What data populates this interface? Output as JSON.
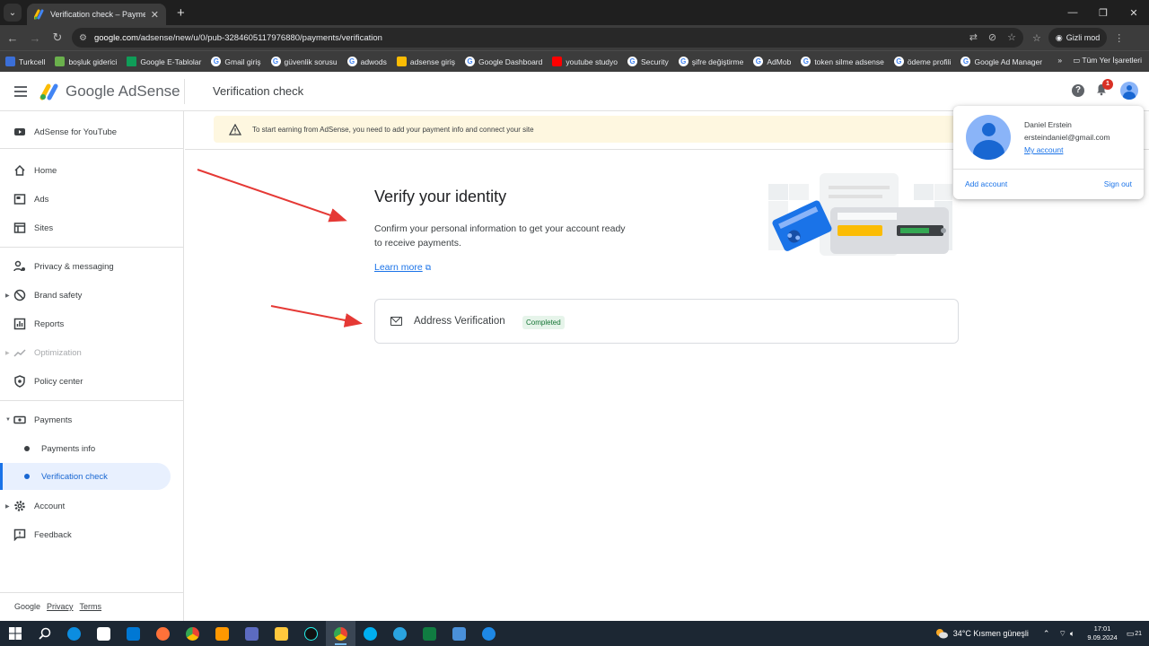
{
  "browser": {
    "tab_title": "Verification check – Payments –",
    "url_host": "google.com",
    "url_path": "/adsense/new/u/0/pub-3284605117976880/payments/verification",
    "incognito_label": "Gizli mod",
    "bookmarks": [
      "Turkcell",
      "boşluk giderici",
      "Google E-Tablolar",
      "Gmail giriş",
      "güvenlik sorusu",
      "adwods",
      "adsense giriş",
      "Google Dashboard",
      "youtube studyo",
      "Security",
      "şifre değiştirme",
      "AdMob",
      "token silme adsense",
      "ödeme profili",
      "Google Ad Manager"
    ],
    "all_bookmarks_label": "Tüm Yer İşaretleri"
  },
  "app": {
    "logo_text": "Google AdSense",
    "page_title": "Verification check",
    "notification_count": "1"
  },
  "sidebar": {
    "youtube": "AdSense for YouTube",
    "home": "Home",
    "ads": "Ads",
    "sites": "Sites",
    "privacy": "Privacy & messaging",
    "brand": "Brand safety",
    "reports": "Reports",
    "optimization": "Optimization",
    "policy": "Policy center",
    "payments": "Payments",
    "payments_info": "Payments info",
    "verification": "Verification check",
    "account": "Account",
    "feedback": "Feedback",
    "footer": {
      "google": "Google",
      "privacy": "Privacy",
      "terms": "Terms"
    }
  },
  "banner": {
    "text": "To start earning from AdSense, you need to add your payment info and connect your site"
  },
  "main": {
    "heading": "Verify your identity",
    "description": "Confirm your personal information to get your account ready to receive payments.",
    "learn_more": "Learn more",
    "card_title": "Address Verification",
    "card_status": "Completed"
  },
  "account_popup": {
    "name": "Daniel Erstein",
    "email": "ersteindaniel@gmail.com",
    "my_account": "My account",
    "add_account": "Add account",
    "sign_out": "Sign out"
  },
  "taskbar": {
    "weather": "34°C  Kısmen güneşli",
    "time": "17:01",
    "date": "9.09.2024",
    "notif_count": "21"
  },
  "colors": {
    "accent": "#1a73e8",
    "active_bg": "#e8f0fe",
    "banner_bg": "#fef7e0",
    "arrow": "#e53935",
    "completed": "#137333"
  }
}
